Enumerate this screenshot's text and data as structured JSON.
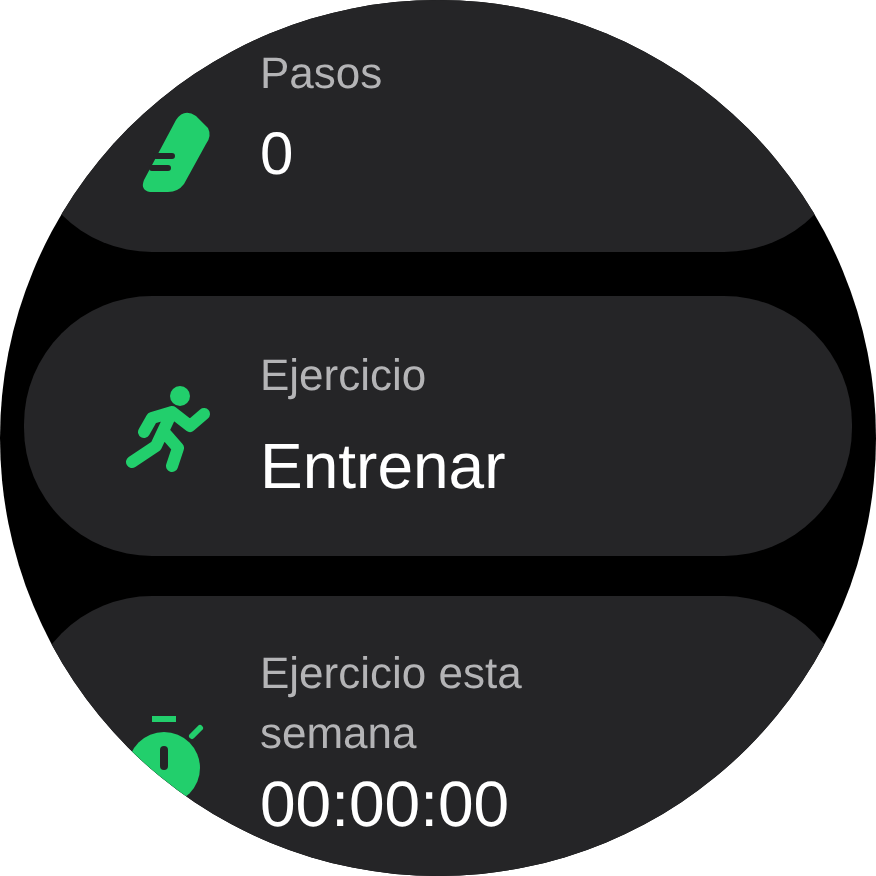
{
  "cards": [
    {
      "kind": "steps",
      "label": "Pasos",
      "value": "0"
    },
    {
      "kind": "exercise",
      "label": "Ejercicio",
      "value": "Entrenar"
    },
    {
      "kind": "timer",
      "label": "Ejercicio esta semana",
      "value": "00:00:00"
    }
  ]
}
